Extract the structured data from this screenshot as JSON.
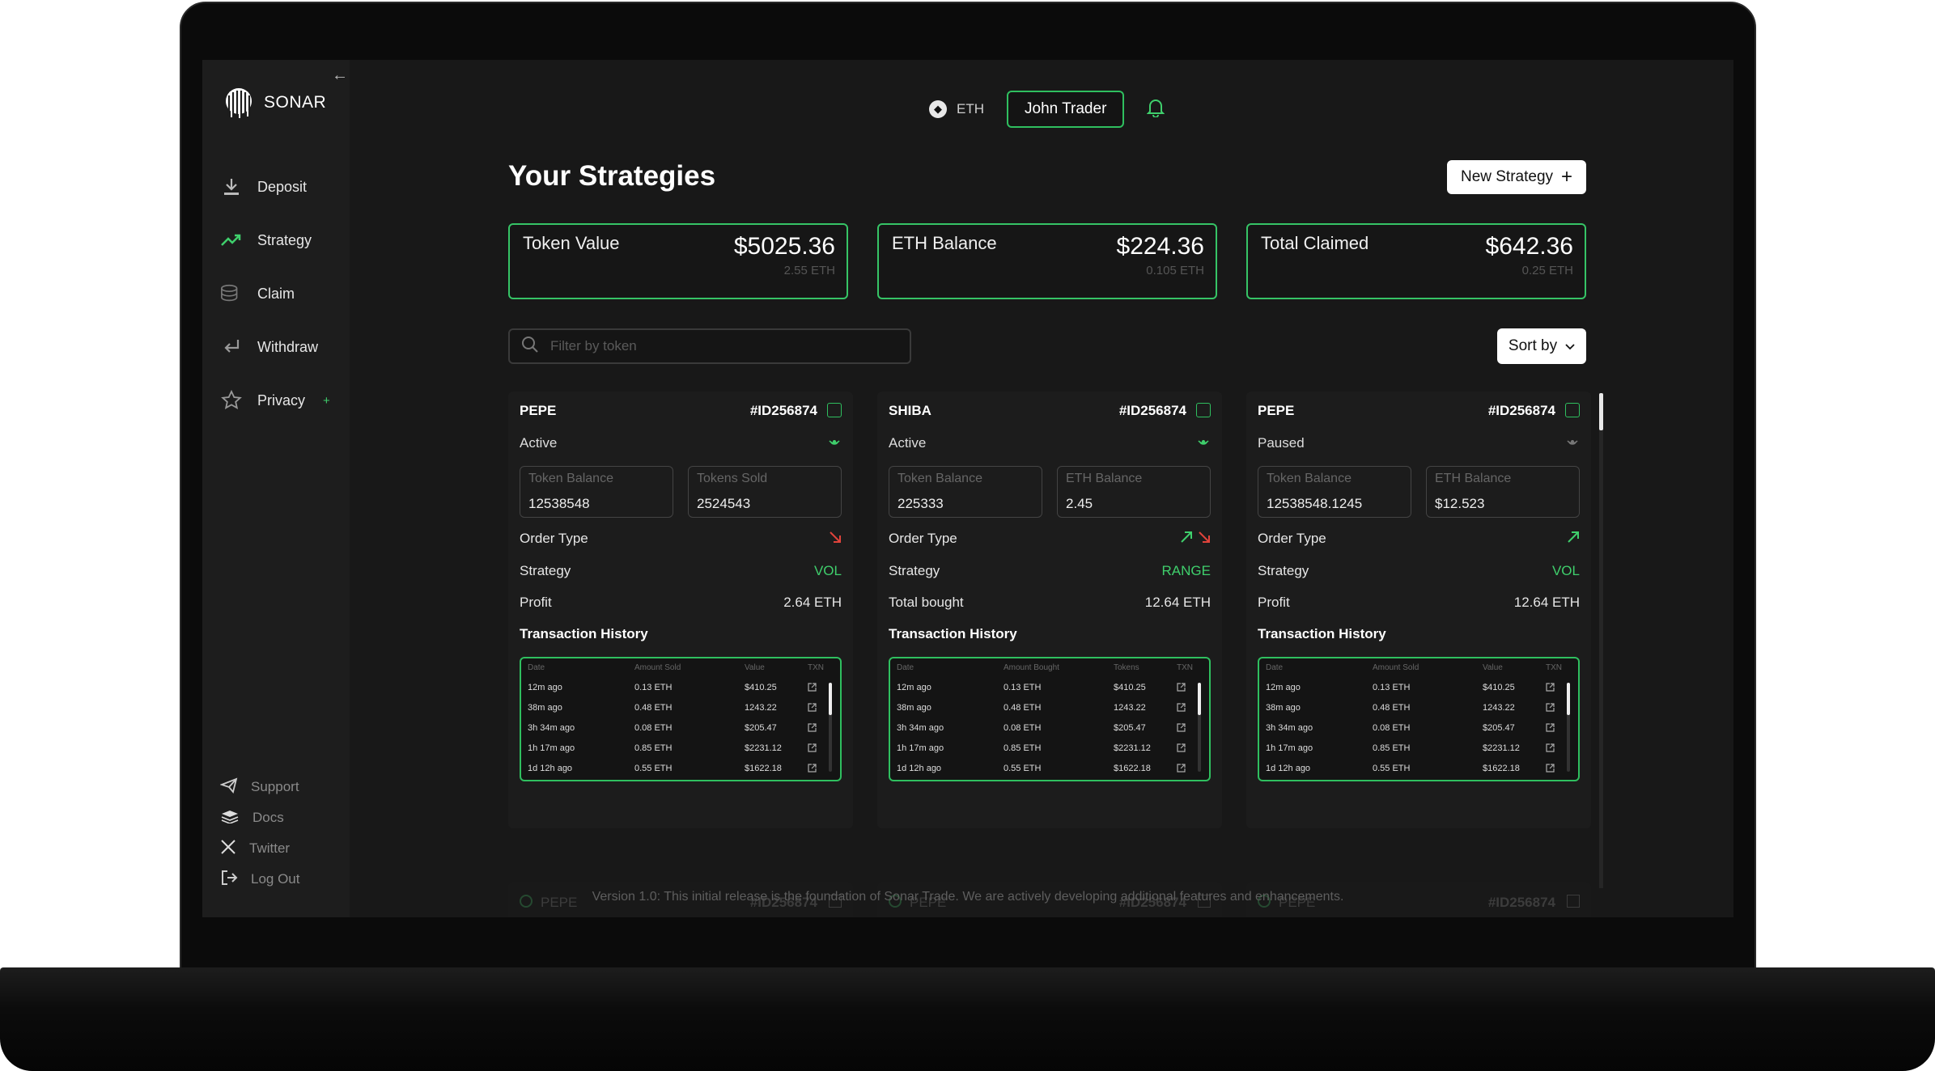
{
  "brand": {
    "name": "SONAR"
  },
  "sidebar": {
    "collapse_icon": "arrow-left-icon",
    "items": [
      {
        "label": "Deposit",
        "icon": "download-icon"
      },
      {
        "label": "Strategy",
        "icon": "trend-up-icon"
      },
      {
        "label": "Claim",
        "icon": "coins-icon"
      },
      {
        "label": "Withdraw",
        "icon": "return-arrow-icon"
      },
      {
        "label": "Privacy",
        "icon": "star-icon",
        "badge": "+"
      }
    ],
    "footer": [
      {
        "label": "Support",
        "icon": "send-icon"
      },
      {
        "label": "Docs",
        "icon": "book-icon"
      },
      {
        "label": "Twitter",
        "icon": "x-logo-icon"
      },
      {
        "label": "Log Out",
        "icon": "logout-icon"
      }
    ]
  },
  "header": {
    "network": "ETH",
    "user": "John Trader",
    "accent": "#2fbf5f"
  },
  "page": {
    "title": "Your Strategies",
    "new_button": "New Strategy",
    "sort_label": "Sort by",
    "filter_placeholder": "Filter by token"
  },
  "stats": [
    {
      "label": "Token Value",
      "value": "$5025.36",
      "sub": "2.55 ETH"
    },
    {
      "label": "ETH Balance",
      "value": "$224.36",
      "sub": "0.105 ETH"
    },
    {
      "label": "Total Claimed",
      "value": "$642.36",
      "sub": "0.25 ETH"
    }
  ],
  "cards": [
    {
      "token": "PEPE",
      "id": "#ID256874",
      "status": "Active",
      "box1_label": "Token Balance",
      "box1_value": "12538548",
      "box2_label": "Tokens Sold",
      "box2_value": "2524543",
      "order_type_label": "Order Type",
      "order_arrows": [
        "down-red"
      ],
      "strategy_label": "Strategy",
      "strategy_value": "VOL",
      "metric_label": "Profit",
      "metric_value": "2.64 ETH",
      "history_title": "Transaction History",
      "history_headers": [
        "Date",
        "Amount Sold",
        "Value",
        "TXN"
      ],
      "history": [
        [
          "12m ago",
          "0.13 ETH",
          "$410.25"
        ],
        [
          "38m ago",
          "0.48 ETH",
          "1243.22"
        ],
        [
          "3h 34m ago",
          "0.08 ETH",
          "$205.47"
        ],
        [
          "1h 17m ago",
          "0.85 ETH",
          "$2231.12"
        ],
        [
          "1d 12h ago",
          "0.55 ETH",
          "$1622.18"
        ]
      ]
    },
    {
      "token": "SHIBA",
      "id": "#ID256874",
      "status": "Active",
      "box1_label": "Token Balance",
      "box1_value": "225333",
      "box2_label": "ETH Balance",
      "box2_value": "2.45",
      "order_type_label": "Order Type",
      "order_arrows": [
        "up-green",
        "down-red"
      ],
      "strategy_label": "Strategy",
      "strategy_value": "RANGE",
      "metric_label": "Total bought",
      "metric_value": "12.64 ETH",
      "history_title": "Transaction History",
      "history_headers": [
        "Date",
        "Amount Bought",
        "Tokens",
        "TXN"
      ],
      "history": [
        [
          "12m ago",
          "0.13 ETH",
          "$410.25"
        ],
        [
          "38m ago",
          "0.48 ETH",
          "1243.22"
        ],
        [
          "3h 34m ago",
          "0.08 ETH",
          "$205.47"
        ],
        [
          "1h 17m ago",
          "0.85 ETH",
          "$2231.12"
        ],
        [
          "1d 12h ago",
          "0.55 ETH",
          "$1622.18"
        ]
      ]
    },
    {
      "token": "PEPE",
      "id": "#ID256874",
      "status": "Paused",
      "box1_label": "Token Balance",
      "box1_value": "12538548.1245",
      "box2_label": "ETH Balance",
      "box2_value": "$12.523",
      "order_type_label": "Order Type",
      "order_arrows": [
        "up-green"
      ],
      "strategy_label": "Strategy",
      "strategy_value": "VOL",
      "metric_label": "Profit",
      "metric_value": "12.64 ETH",
      "history_title": "Transaction History",
      "history_headers": [
        "Date",
        "Amount Sold",
        "Value",
        "TXN"
      ],
      "history": [
        [
          "12m ago",
          "0.13 ETH",
          "$410.25"
        ],
        [
          "38m ago",
          "0.48 ETH",
          "1243.22"
        ],
        [
          "3h 34m ago",
          "0.08 ETH",
          "$205.47"
        ],
        [
          "1h 17m ago",
          "0.85 ETH",
          "$2231.12"
        ],
        [
          "1d 12h ago",
          "0.55 ETH",
          "$1622.18"
        ]
      ]
    }
  ],
  "ghost_cards": [
    {
      "token": "PEPE",
      "id": "#ID256874"
    },
    {
      "token": "PEPE",
      "id": "#ID256874"
    },
    {
      "token": "PEPE",
      "id": "#ID256874"
    }
  ],
  "footer_note": "Version 1.0: This initial release is the foundation of Sonar Trade. We are actively developing additional features and enhancements."
}
